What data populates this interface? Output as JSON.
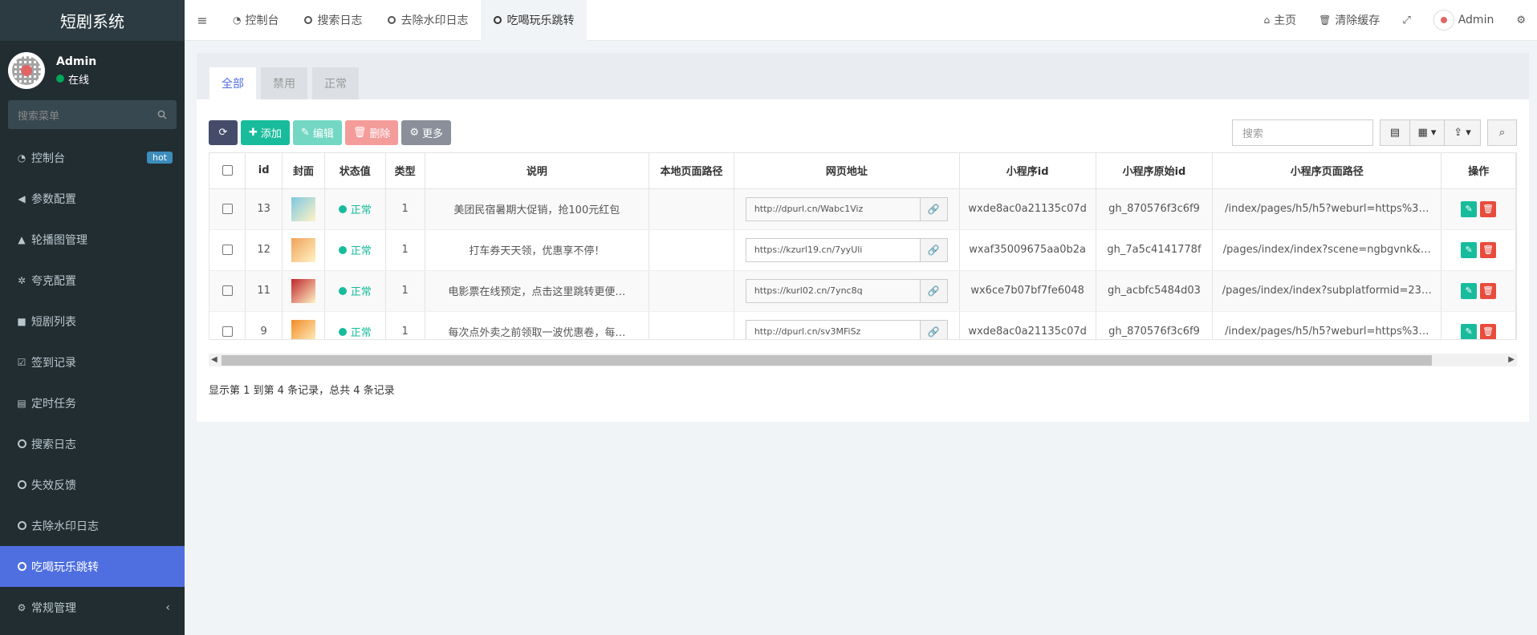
{
  "app": {
    "title": "短剧系统"
  },
  "user": {
    "name": "Admin",
    "status": "在线"
  },
  "sidebar": {
    "search_placeholder": "搜索菜单",
    "items": [
      {
        "label": "控制台",
        "icon": "dashboard-icon",
        "badge": "hot"
      },
      {
        "label": "参数配置",
        "icon": "bullhorn-icon"
      },
      {
        "label": "轮播图管理",
        "icon": "area-chart-icon"
      },
      {
        "label": "夸克配置",
        "icon": "gear-icon"
      },
      {
        "label": "短剧列表",
        "icon": "video-camera-icon"
      },
      {
        "label": "签到记录",
        "icon": "calendar-check-icon"
      },
      {
        "label": "定时任务",
        "icon": "file-code-icon"
      },
      {
        "label": "搜索日志",
        "icon": "circle-icon"
      },
      {
        "label": "失效反馈",
        "icon": "circle-icon"
      },
      {
        "label": "去除水印日志",
        "icon": "circle-icon"
      },
      {
        "label": "吃喝玩乐跳转",
        "icon": "circle-icon",
        "active": true
      },
      {
        "label": "常规管理",
        "icon": "cogs-icon"
      }
    ]
  },
  "topnav": {
    "tabs": [
      {
        "label": "控制台"
      },
      {
        "label": "搜索日志"
      },
      {
        "label": "去除水印日志"
      },
      {
        "label": "吃喝玩乐跳转",
        "active": true
      }
    ],
    "home": "主页",
    "clear_cache": "清除缓存",
    "user": "Admin"
  },
  "panel": {
    "tabs": [
      {
        "label": "全部",
        "active": true
      },
      {
        "label": "禁用"
      },
      {
        "label": "正常"
      }
    ]
  },
  "toolbar": {
    "add": "添加",
    "edit": "编辑",
    "delete": "删除",
    "more": "更多",
    "search_placeholder": "搜索"
  },
  "table": {
    "columns": [
      "id",
      "封面",
      "状态值",
      "类型",
      "说明",
      "本地页面路径",
      "网页地址",
      "小程序id",
      "小程序原始id",
      "小程序页面路径",
      "操作"
    ],
    "rows": [
      {
        "id": "13",
        "status": "正常",
        "type": "1",
        "desc": "美团民宿暑期大促销，抢100元红包",
        "local_path": "",
        "url": "http://dpurl.cn/Wabc1Viz",
        "appid": "wxde8ac0a21135c07d",
        "origin_id": "gh_870576f3c6f9",
        "page_path": "/index/pages/h5/h5?weburl=https%3…",
        "cover_color": "#7ec8e3"
      },
      {
        "id": "12",
        "status": "正常",
        "type": "1",
        "desc": "打车券天天领，优惠享不停！",
        "local_path": "",
        "url": "https://kzurl19.cn/7yyUli",
        "appid": "wxaf35009675aa0b2a",
        "origin_id": "gh_7a5c4141778f",
        "page_path": "/pages/index/index?scene=ngbgvnk&…",
        "cover_color": "#f0a25a"
      },
      {
        "id": "11",
        "status": "正常",
        "type": "1",
        "desc": "电影票在线预定，点击这里跳转更便…",
        "local_path": "",
        "url": "https://kurl02.cn/7ync8q",
        "appid": "wx6ce7b07bf7fe6048",
        "origin_id": "gh_acbfc5484d03",
        "page_path": "/pages/index/index?subplatformid=23…",
        "cover_color": "#c0262d"
      },
      {
        "id": "9",
        "status": "正常",
        "type": "1",
        "desc": "每次点外卖之前领取一波优惠卷，每…",
        "local_path": "",
        "url": "http://dpurl.cn/sv3MFiSz",
        "appid": "wxde8ac0a21135c07d",
        "origin_id": "gh_870576f3c6f9",
        "page_path": "/index/pages/h5/h5?weburl=https%3…",
        "cover_color": "#f28c28"
      }
    ]
  },
  "pager": {
    "summary": "显示第 1 到第 4 条记录，总共 4 条记录"
  },
  "colors": {
    "sidebar_bg": "#222d32",
    "active_menu": "#4f6fe1",
    "success": "#18bc9c",
    "danger": "#e74c3c"
  }
}
